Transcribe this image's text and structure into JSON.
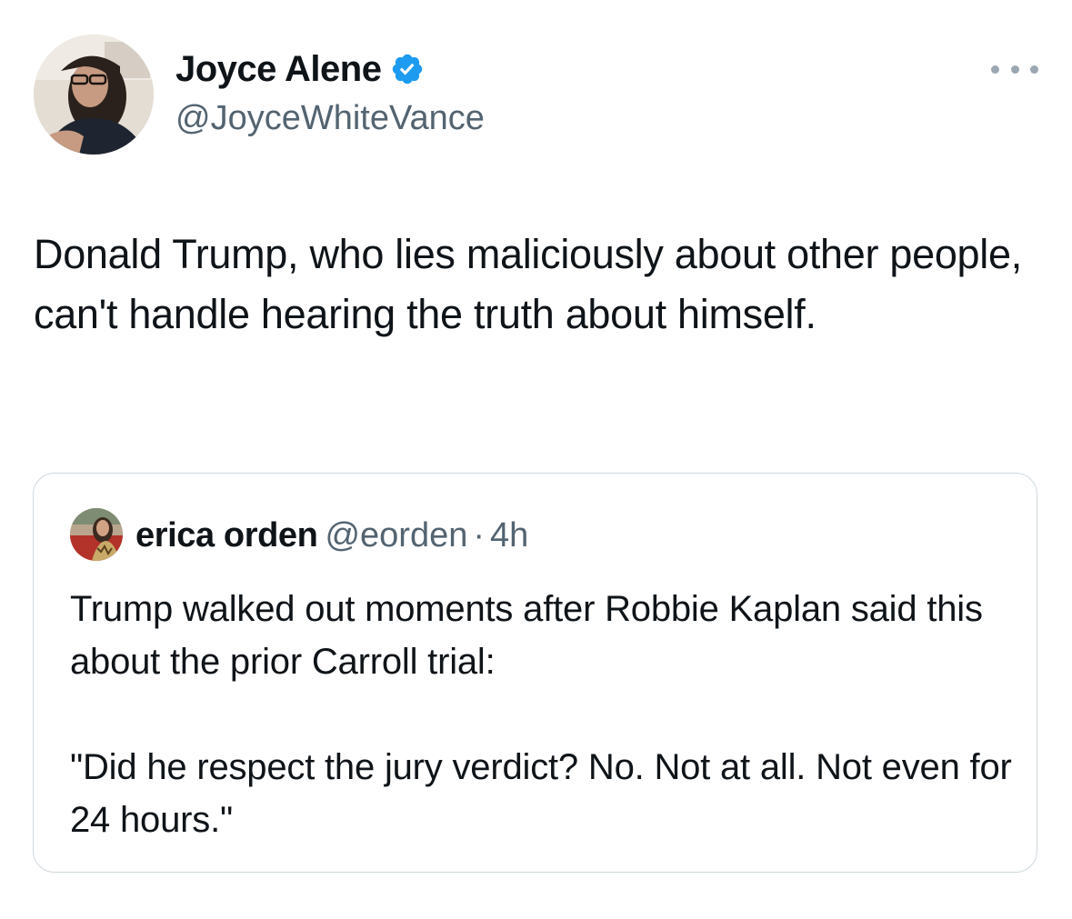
{
  "author": {
    "display_name": "Joyce Alene",
    "handle": "@JoyceWhiteVance",
    "verified": true,
    "avatar_icon": "profile-photo"
  },
  "more_icon": "more-dots-icon",
  "tweet": {
    "text": "Donald Trump, who lies maliciously about other people, can't handle hearing the truth about himself."
  },
  "quoted_tweet": {
    "display_name": "erica orden",
    "handle": "@eorden",
    "separator": "·",
    "time": "4h",
    "text": "Trump walked out moments after Robbie Kaplan said this about the prior Carroll trial:\n\n\"Did he respect the jury verdict? No. Not at all. Not even for 24 hours.\""
  },
  "colors": {
    "text": "#0f1419",
    "secondary": "#536471",
    "verified_blue": "#1d9bf0",
    "border": "#cfd9de"
  }
}
